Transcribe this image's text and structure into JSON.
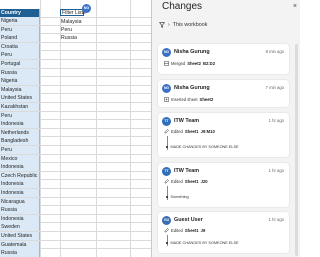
{
  "sheet": {
    "header": "Country",
    "countries": [
      "Nigeria",
      "Peru",
      "Poland",
      "Croatia",
      "Peru",
      "Portugal",
      "Russia",
      "Nigeria",
      "Malaysia",
      "United States",
      "Kazakhstan",
      "Peru",
      "Indonesia",
      "Netherlands",
      "Bangladesh",
      "Peru",
      "Mexico",
      "Indonesia",
      "Czech Republic",
      "Indonesia",
      "Indonesia",
      "Nicaragua",
      "Russia",
      "Indonesia",
      "Sweden",
      "United States",
      "Guatemala",
      "Russia"
    ],
    "filter_cell": "Filter Lists",
    "list_values": [
      "Malaysia",
      "Peru",
      "Russia"
    ],
    "collaborator_badge": "NG"
  },
  "pane": {
    "title": "Changes",
    "close_glyph": "×",
    "filter_label": "This workbook",
    "cards": [
      {
        "initials": "NG",
        "avatar_color": "#3b6fc4",
        "user": "Nisha Gurung",
        "time": "8 min ago",
        "icon": "merged-cells-icon",
        "action_verb": "Merged",
        "sheet": "Sheet2",
        "range": "B2:D2",
        "details": []
      },
      {
        "initials": "NG",
        "avatar_color": "#3b6fc4",
        "user": "Nisha Gurung",
        "time": "7 min ago",
        "icon": "inserted-sheet-icon",
        "action_verb": "Inserted sheet",
        "sheet": "Sheet2",
        "range": "",
        "details": []
      },
      {
        "initials": "TT",
        "avatar_color": "#2f6fb8",
        "user": "ITW Team",
        "time": "1 hr ago",
        "icon": "edit-pencil-icon",
        "action_verb": "Edited",
        "sheet": "Sheet1",
        "range": "J9:M10",
        "details": [
          "MADE CHANGES BY SOMEONE ELSE"
        ]
      },
      {
        "initials": "TT",
        "avatar_color": "#2f6fb8",
        "user": "ITW Team",
        "time": "1 hr ago",
        "icon": "edit-pencil-icon",
        "action_verb": "Edited",
        "sheet": "Sheet1",
        "range": "J20",
        "details": [
          "Something"
        ]
      },
      {
        "initials": "GU",
        "avatar_color": "#3a6db5",
        "user": "Guest User",
        "time": "1 hr ago",
        "icon": "edit-pencil-icon",
        "action_verb": "Edited",
        "sheet": "Sheet1",
        "range": "J9",
        "details": [
          "MADE CHANGES BY SOMEONE ELSE"
        ]
      }
    ]
  }
}
